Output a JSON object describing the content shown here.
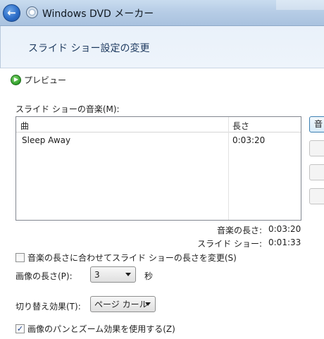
{
  "window": {
    "title": "Windows DVD メーカー"
  },
  "header": {
    "page_title": "スライド ショー設定の変更"
  },
  "preview": {
    "label": "プレビュー",
    "icon": "play-icon"
  },
  "music": {
    "section_label": "スライド ショーの音楽(M):",
    "columns": [
      "曲",
      "長さ"
    ],
    "rows": [
      {
        "song": "Sleep Away",
        "length": "0:03:20"
      }
    ],
    "side_buttons": [
      "音"
    ]
  },
  "stats": {
    "music_length_label": "音楽の長さ:",
    "music_length_value": "0:03:20",
    "slideshow_label": "スライド ショー:",
    "slideshow_value": "0:01:33"
  },
  "options": {
    "match_length_label": "音楽の長さに合わせてスライド ショーの長さを変更(S)",
    "match_length_checked": false,
    "image_length_label": "画像の長さ(P):",
    "image_length_value": "3",
    "image_length_unit": "秒",
    "transition_label": "切り替え効果(T):",
    "transition_value": "ページ カール",
    "pan_zoom_label": "画像のパンとズーム効果を使用する(Z)",
    "pan_zoom_checked": true
  },
  "colors": {
    "titlebar": "#b7cde6",
    "header_band": "#eef4fb",
    "page_title": "#1e3a5f",
    "back_button": "#2d6ec9",
    "play_icon": "#2f9e2a"
  }
}
